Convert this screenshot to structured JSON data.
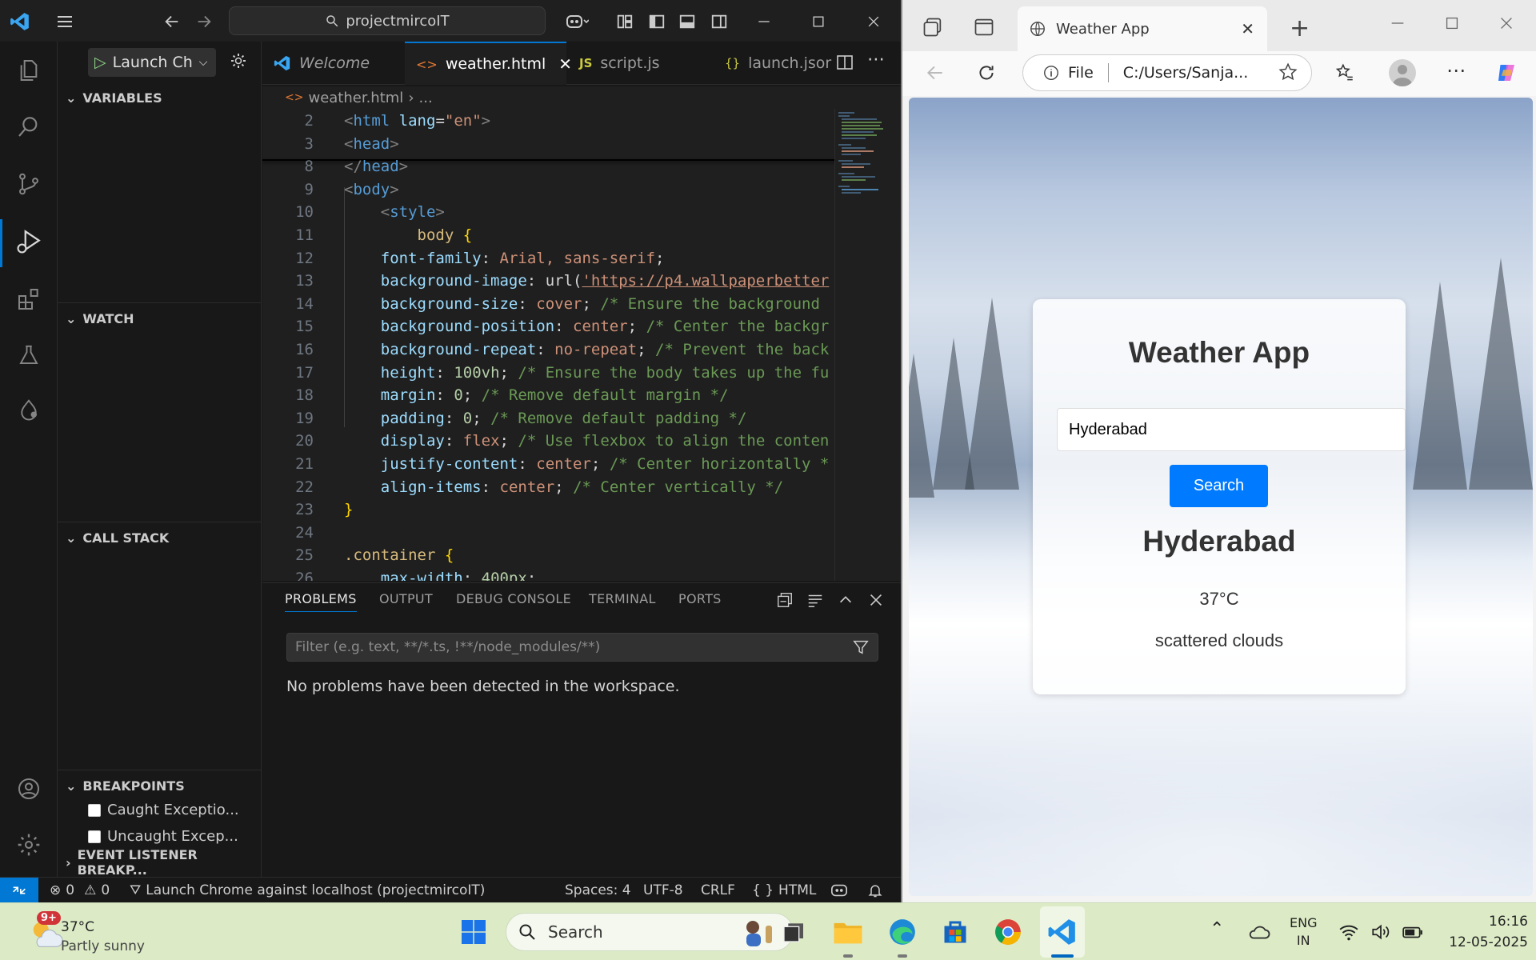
{
  "vscode": {
    "title_search": "projectmircoIT",
    "debug_config": "Launch Ch",
    "sections": {
      "variables": "VARIABLES",
      "watch": "WATCH",
      "call_stack": "CALL STACK",
      "breakpoints": "BREAKPOINTS",
      "event_listener": "EVENT LISTENER BREAKP..."
    },
    "breakpoints": [
      {
        "label": "Caught Exceptio...",
        "checked": false
      },
      {
        "label": "Uncaught Excep...",
        "checked": false
      }
    ],
    "tabs": [
      {
        "label": "Welcome",
        "icon": "vscode-icon",
        "active": false
      },
      {
        "label": "weather.html",
        "icon": "html-icon",
        "active": true
      },
      {
        "label": "script.js",
        "icon": "js-icon",
        "active": false
      },
      {
        "label": "launch.jsor",
        "icon": "json-icon",
        "active": false
      }
    ],
    "breadcrumb": {
      "file": "weather.html",
      "rest": "..."
    },
    "code_lines": [
      {
        "n": "2",
        "html": "<span class='pun'>&lt;</span><span class='tag'>html</span> <span class='attr'>lang</span><span class='plain'>=</span><span class='str'>\"en\"</span><span class='pun'>&gt;</span>"
      },
      {
        "n": "3",
        "html": "<span class='pun'>&lt;</span><span class='tag'>head</span><span class='pun'>&gt;</span>"
      },
      {
        "n": "8",
        "html": "<span class='pun'>&lt;/</span><span class='tag'>head</span><span class='pun'>&gt;</span>"
      },
      {
        "n": "9",
        "html": "<span class='pun'>&lt;</span><span class='tag'>body</span><span class='pun'>&gt;</span>"
      },
      {
        "n": "10",
        "html": "    <span class='pun'>&lt;</span><span class='tag'>style</span><span class='pun'>&gt;</span>"
      },
      {
        "n": "11",
        "html": "        <span class='sel'>body</span> <span class='brc'>{</span>"
      },
      {
        "n": "12",
        "html": "    <span class='prop'>font-family</span><span class='plain'>:</span> <span class='val'>Arial, sans-serif</span><span class='plain'>;</span>"
      },
      {
        "n": "13",
        "html": "    <span class='prop'>background-image</span><span class='plain'>:</span> <span class='plain'>url(</span><span class='str' style='text-decoration:underline'>'https://p4.wallpaperbetter</span>"
      },
      {
        "n": "14",
        "html": "    <span class='prop'>background-size</span><span class='plain'>:</span> <span class='val'>cover</span><span class='plain'>;</span> <span class='com'>/* Ensure the background</span>"
      },
      {
        "n": "15",
        "html": "    <span class='prop'>background-position</span><span class='plain'>:</span> <span class='val'>center</span><span class='plain'>;</span> <span class='com'>/* Center the backgr</span>"
      },
      {
        "n": "16",
        "html": "    <span class='prop'>background-repeat</span><span class='plain'>:</span> <span class='val'>no-repeat</span><span class='plain'>;</span> <span class='com'>/* Prevent the back</span>"
      },
      {
        "n": "17",
        "html": "    <span class='prop'>height</span><span class='plain'>:</span> <span class='num'>100vh</span><span class='plain'>;</span> <span class='com'>/* Ensure the body takes up the fu</span>"
      },
      {
        "n": "18",
        "html": "    <span class='prop'>margin</span><span class='plain'>:</span> <span class='num'>0</span><span class='plain'>;</span> <span class='com'>/* Remove default margin */</span>"
      },
      {
        "n": "19",
        "html": "    <span class='prop'>padding</span><span class='plain'>:</span> <span class='num'>0</span><span class='plain'>;</span> <span class='com'>/* Remove default padding */</span>"
      },
      {
        "n": "20",
        "html": "    <span class='prop'>display</span><span class='plain'>:</span> <span class='val'>flex</span><span class='plain'>;</span> <span class='com'>/* Use flexbox to align the conten</span>"
      },
      {
        "n": "21",
        "html": "    <span class='prop'>justify-content</span><span class='plain'>:</span> <span class='val'>center</span><span class='plain'>;</span> <span class='com'>/* Center horizontally *</span>"
      },
      {
        "n": "22",
        "html": "    <span class='prop'>align-items</span><span class='plain'>:</span> <span class='val'>center</span><span class='plain'>;</span> <span class='com'>/* Center vertically */</span>"
      },
      {
        "n": "23",
        "html": "<span class='brc'>}</span>"
      },
      {
        "n": "24",
        "html": ""
      },
      {
        "n": "25",
        "html": "<span class='sel'>.container</span> <span class='brc'>{</span>"
      },
      {
        "n": "26",
        "html": "    <span class='prop'>max-width</span><span class='plain'>:</span> <span class='num'>400px</span><span class='plain'>;</span>"
      }
    ],
    "panel_tabs": [
      "PROBLEMS",
      "OUTPUT",
      "DEBUG CONSOLE",
      "TERMINAL",
      "PORTS"
    ],
    "filter_placeholder": "Filter (e.g. text, **/*.ts, !**/node_modules/**)",
    "problems_message": "No problems have been detected in the workspace.",
    "status": {
      "errors": "0",
      "warnings": "0",
      "launch": "Launch Chrome against localhost (projectmircoIT)",
      "spaces": "Spaces: 4",
      "encoding": "UTF-8",
      "eol": "CRLF",
      "language": "HTML"
    }
  },
  "edge": {
    "tab_title": "Weather App",
    "address_scheme": "File",
    "address_path": "C:/Users/Sanja...",
    "page": {
      "heading": "Weather App",
      "input_value": "Hyderabad",
      "button_label": "Search",
      "result_city": "Hyderabad",
      "result_temp": "37°C",
      "result_desc": "scattered clouds"
    }
  },
  "taskbar": {
    "weather_badge": "9+",
    "weather_temp": "37°C",
    "weather_desc": "Partly sunny",
    "search_label": "Search",
    "lang_top": "ENG",
    "lang_bottom": "IN",
    "time": "16:16",
    "date": "12-05-2025"
  },
  "colors": {
    "accent": "#0078d4",
    "search_button": "#007bff",
    "taskbar_bg": "#dcebc6"
  }
}
